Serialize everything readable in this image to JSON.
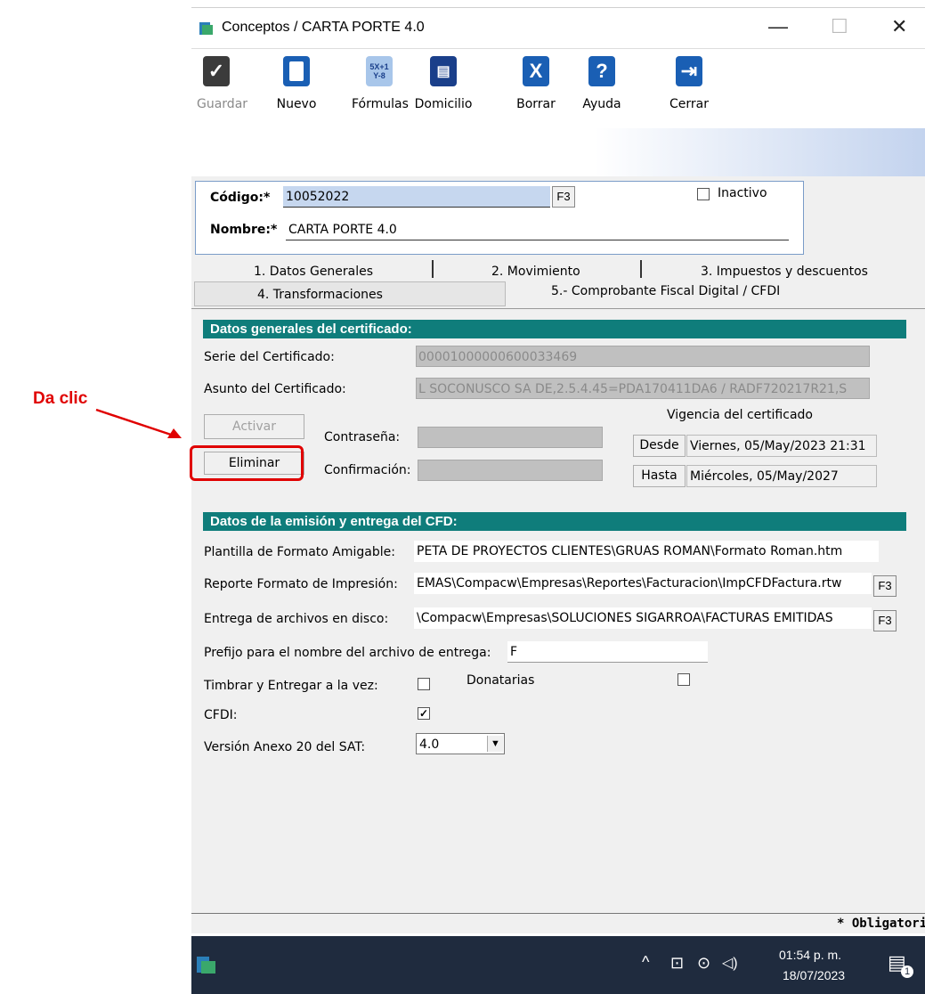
{
  "annotation": {
    "text": "Da clic",
    "color": "#e00000"
  },
  "window": {
    "title": "Conceptos / CARTA PORTE 4.0",
    "controls": {
      "minimize": "—",
      "maximize": "☐",
      "close": "✕"
    }
  },
  "toolbar": {
    "guardar": "Guardar",
    "nuevo": "Nuevo",
    "formulas": "Fórmulas",
    "domicilio": "Domicilio",
    "borrar": "Borrar",
    "ayuda": "Ayuda",
    "cerrar": "Cerrar"
  },
  "header": {
    "codigo_label": "Código:*",
    "codigo_value": "10052022",
    "f3": "F3",
    "inactivo_label": "Inactivo",
    "nombre_label": "Nombre:*",
    "nombre_value": "CARTA PORTE 4.0"
  },
  "tabs": {
    "tab1": "1. Datos Generales",
    "tab2": "2. Movimiento",
    "tab3": "3. Impuestos y descuentos",
    "tab4": "4. Transformaciones",
    "tab5": "5.- Comprobante Fiscal Digital / CFDI"
  },
  "cert": {
    "section_title": "Datos generales del certificado:",
    "serie_label": "Serie del Certificado:",
    "serie_value": "00001000000600033469",
    "asunto_label": "Asunto del Certificado:",
    "asunto_value": "L SOCONUSCO SA DE,2.5.4.45=PDA170411DA6 / RADF720217R21,S",
    "activar": "Activar",
    "eliminar": "Eliminar",
    "contrasena_label": "Contraseña:",
    "confirmacion_label": "Confirmación:",
    "vigencia_label": "Vigencia del certificado",
    "desde_label": "Desde",
    "desde_value": "Viernes, 05/May/2023 21:31",
    "hasta_label": "Hasta",
    "hasta_value": "Miércoles, 05/May/2027"
  },
  "emision": {
    "section_title": "Datos de la emisión y entrega del CFD:",
    "plantilla_label": "Plantilla de Formato Amigable:",
    "plantilla_value": "PETA DE PROYECTOS CLIENTES\\GRUAS ROMAN\\Formato Roman.htm",
    "reporte_label": "Reporte Formato de Impresión:",
    "reporte_value": "EMAS\\Compacw\\Empresas\\Reportes\\Facturacion\\ImpCFDFactura.rtw",
    "entrega_label": "Entrega de archivos en disco:",
    "entrega_value": "\\Compacw\\Empresas\\SOLUCIONES SIGARROA\\FACTURAS EMITIDAS",
    "prefijo_label": "Prefijo para el nombre del archivo de entrega:",
    "prefijo_value": "F",
    "timbrar_label": "Timbrar y Entregar a la vez:",
    "donatarias_label": "Donatarias",
    "cfdi_label": "CFDI:",
    "cfdi_check": "✓",
    "version_label": "Versión Anexo 20 del SAT:",
    "version_value": "4.0"
  },
  "status": {
    "obligatorio": "* Obligatorio"
  },
  "taskbar": {
    "time": "01:54 p. m.",
    "date": "18/07/2023",
    "notifications": "1"
  }
}
